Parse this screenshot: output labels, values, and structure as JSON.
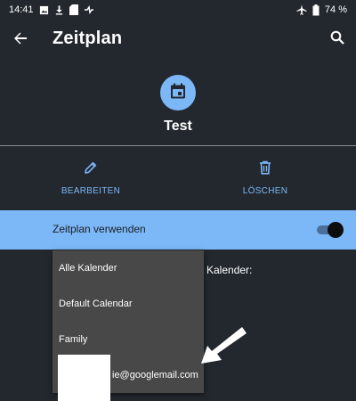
{
  "status_bar": {
    "time": "14:41",
    "battery": "74 %",
    "icons_left": [
      "image-icon",
      "download-icon",
      "sd-card-icon",
      "signal-off-icon"
    ],
    "icons_right": [
      "airplane-icon",
      "battery-icon"
    ]
  },
  "app_bar": {
    "title": "Zeitplan",
    "back_icon": "arrow-back-icon",
    "search_icon": "search-icon"
  },
  "schedule": {
    "name": "Test",
    "icon": "calendar-icon"
  },
  "actions": {
    "edit_label": "BEARBEITEN",
    "delete_label": "LÖSCHEN"
  },
  "use_schedule": {
    "label": "Zeitplan verwenden",
    "enabled": true
  },
  "calendar_label": "Kalender:",
  "dropdown": {
    "options": [
      "Alle Kalender",
      "Default Calendar",
      "Family",
      "ie@googlemail.com"
    ]
  },
  "colors": {
    "background": "#23282e",
    "accent": "#7cb8f8",
    "menu": "#484848"
  }
}
